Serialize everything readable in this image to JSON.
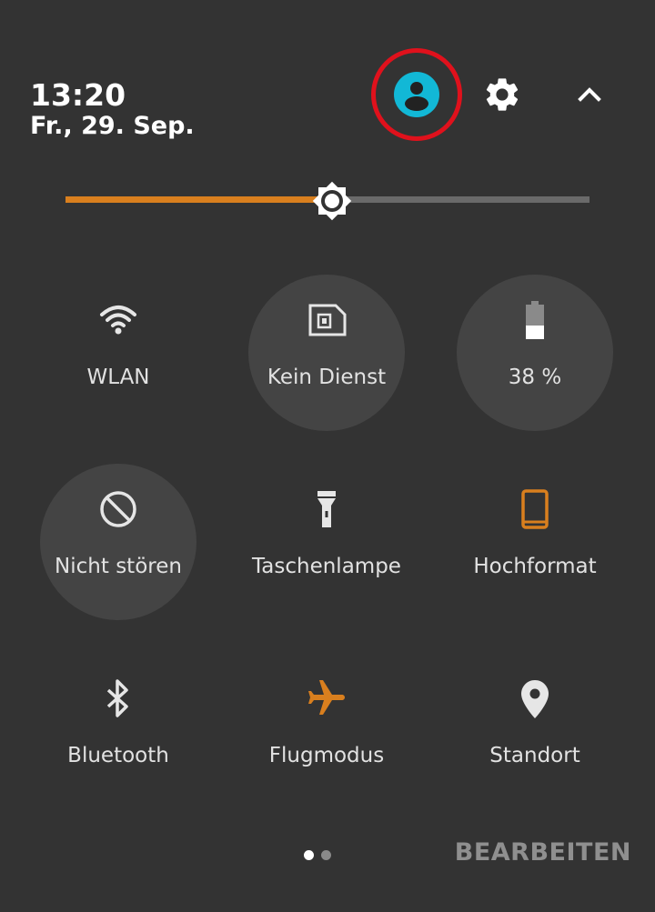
{
  "header": {
    "time": "13:20",
    "date": "Fr., 29. Sep."
  },
  "icons": {
    "user": "account-circle-icon",
    "settings": "gear-icon",
    "collapse": "chevron-up-icon",
    "brightness": "brightness-icon"
  },
  "brightness": {
    "level_percent": 51
  },
  "tiles": [
    {
      "label": "WLAN",
      "icon": "wifi-icon",
      "active_bg": false,
      "icon_color": "#e6e6e6"
    },
    {
      "label": "Kein Dienst",
      "icon": "sim-card-icon",
      "active_bg": true,
      "icon_color": "#e6e6e6"
    },
    {
      "label": "38 %",
      "icon": "battery-icon",
      "active_bg": true,
      "icon_color": "#ffffff"
    },
    {
      "label": "Nicht stören",
      "icon": "do-not-disturb-icon",
      "active_bg": true,
      "icon_color": "#e6e6e6"
    },
    {
      "label": "Taschenlampe",
      "icon": "flashlight-icon",
      "active_bg": false,
      "icon_color": "#e6e6e6"
    },
    {
      "label": "Hochformat",
      "icon": "portrait-phone-icon",
      "active_bg": false,
      "icon_color": "#d97f1e"
    },
    {
      "label": "Bluetooth",
      "icon": "bluetooth-icon",
      "active_bg": false,
      "icon_color": "#e6e6e6"
    },
    {
      "label": "Flugmodus",
      "icon": "airplane-icon",
      "active_bg": false,
      "icon_color": "#d97f1e"
    },
    {
      "label": "Standort",
      "icon": "location-pin-icon",
      "active_bg": false,
      "icon_color": "#e6e6e6"
    }
  ],
  "pagination": {
    "current_page": 1,
    "total_pages": 2
  },
  "footer": {
    "edit_label": "BEARBEITEN"
  },
  "colors": {
    "background": "#333333",
    "accent": "#d97f1e",
    "user_icon": "#12b8d6",
    "highlight_circle": "#e0111c",
    "dot_active": "#ffffff",
    "dot_inactive": "#8a8a8a"
  }
}
